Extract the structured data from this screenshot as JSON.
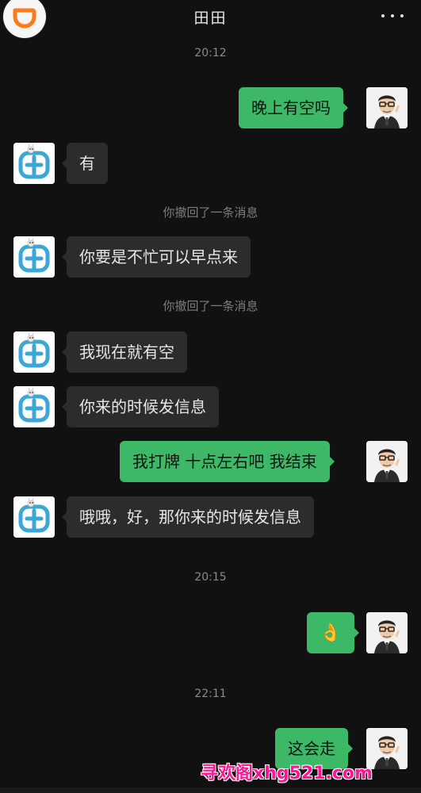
{
  "header": {
    "title": "田田",
    "logo_icon": "didi-logo-icon",
    "more_icon": "more-dots-icon"
  },
  "colors": {
    "background": "#111111",
    "bubble_self": "#3db866",
    "bubble_other": "#2c2c2c",
    "logo_orange": "#ff7a1a",
    "watermark": "#ff1493"
  },
  "messages": [
    {
      "type": "timestamp",
      "text": "20:12"
    },
    {
      "type": "message",
      "side": "right",
      "text": "晚上有空吗"
    },
    {
      "type": "message",
      "side": "left",
      "text": "有"
    },
    {
      "type": "system",
      "text": "你撤回了一条消息"
    },
    {
      "type": "message",
      "side": "left",
      "text": "你要是不忙可以早点来"
    },
    {
      "type": "system",
      "text": "你撤回了一条消息"
    },
    {
      "type": "message",
      "side": "left",
      "text": "我现在就有空"
    },
    {
      "type": "message",
      "side": "left",
      "text": "你来的时候发信息"
    },
    {
      "type": "message",
      "side": "right",
      "text": "我打牌 十点左右吧 我结束"
    },
    {
      "type": "message",
      "side": "left",
      "text": "哦哦，好，那你来的时候发信息"
    },
    {
      "type": "timestamp",
      "text": "20:15"
    },
    {
      "type": "message",
      "side": "right",
      "text": "👌"
    },
    {
      "type": "timestamp",
      "text": "22:11"
    },
    {
      "type": "message",
      "side": "right",
      "text": "这会走"
    }
  ],
  "watermark": "寻欢阁xhg521.com"
}
